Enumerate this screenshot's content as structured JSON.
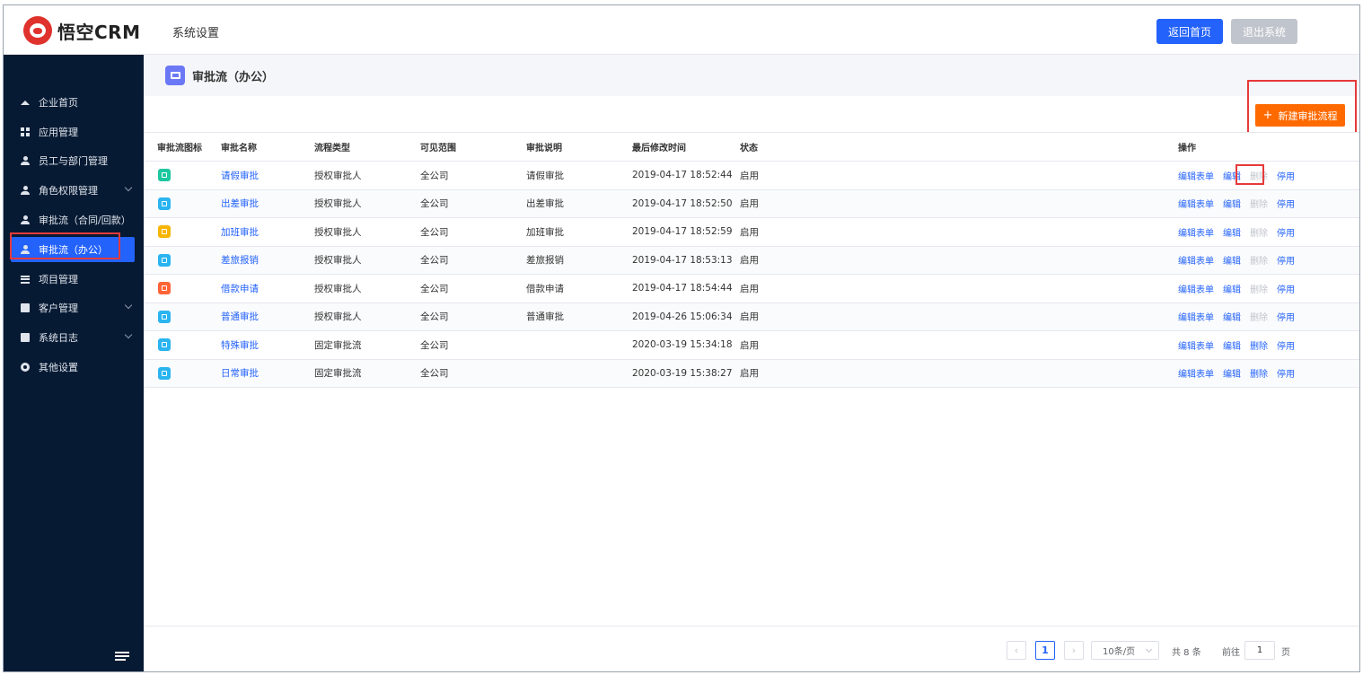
{
  "header": {
    "logo_text": "悟空CRM",
    "page_title": "系统设置",
    "home_button": "返回首页",
    "exit_button": "退出系统"
  },
  "sidebar": {
    "items": [
      {
        "label": "企业首页",
        "icon": "home-icon",
        "expandable": false,
        "active": false
      },
      {
        "label": "应用管理",
        "icon": "apps-grid-icon",
        "expandable": false,
        "active": false
      },
      {
        "label": "员工与部门管理",
        "icon": "users-icon",
        "expandable": false,
        "active": false
      },
      {
        "label": "角色权限管理",
        "icon": "user-role-icon",
        "expandable": true,
        "active": false
      },
      {
        "label": "审批流（合同/回款）",
        "icon": "user-flow-icon",
        "expandable": false,
        "active": false
      },
      {
        "label": "审批流（办公）",
        "icon": "user-flow-icon",
        "expandable": false,
        "active": true
      },
      {
        "label": "项目管理",
        "icon": "list-icon",
        "expandable": false,
        "active": false
      },
      {
        "label": "客户管理",
        "icon": "building-icon",
        "expandable": true,
        "active": false
      },
      {
        "label": "系统日志",
        "icon": "log-icon",
        "expandable": true,
        "active": false
      },
      {
        "label": "其他设置",
        "icon": "gear-icon",
        "expandable": false,
        "active": false
      }
    ]
  },
  "main": {
    "breadcrumb_title": "审批流（办公）",
    "new_button": "新建审批流程",
    "columns": [
      "审批流图标",
      "审批名称",
      "流程类型",
      "可见范围",
      "审批说明",
      "最后修改时间",
      "状态",
      "操作"
    ],
    "rows": [
      {
        "icon_color": "#1dc7a0",
        "name": "请假审批",
        "type": "授权审批人",
        "scope": "全公司",
        "desc": "请假审批",
        "modified": "2019-04-17 18:52:44",
        "status": "启用",
        "delete_disabled": true
      },
      {
        "icon_color": "#2ab4f0",
        "name": "出差审批",
        "type": "授权审批人",
        "scope": "全公司",
        "desc": "出差审批",
        "modified": "2019-04-17 18:52:50",
        "status": "启用",
        "delete_disabled": true
      },
      {
        "icon_color": "#f7b500",
        "name": "加班审批",
        "type": "授权审批人",
        "scope": "全公司",
        "desc": "加班审批",
        "modified": "2019-04-17 18:52:59",
        "status": "启用",
        "delete_disabled": true
      },
      {
        "icon_color": "#2ab4f0",
        "name": "差旅报销",
        "type": "授权审批人",
        "scope": "全公司",
        "desc": "差旅报销",
        "modified": "2019-04-17 18:53:13",
        "status": "启用",
        "delete_disabled": true
      },
      {
        "icon_color": "#ff6437",
        "name": "借款申请",
        "type": "授权审批人",
        "scope": "全公司",
        "desc": "借款申请",
        "modified": "2019-04-17 18:54:44",
        "status": "启用",
        "delete_disabled": true
      },
      {
        "icon_color": "#2ab4f0",
        "name": "普通审批",
        "type": "授权审批人",
        "scope": "全公司",
        "desc": "普通审批",
        "modified": "2019-04-26 15:06:34",
        "status": "启用",
        "delete_disabled": true
      },
      {
        "icon_color": "#2ab4f0",
        "name": "特殊审批",
        "type": "固定审批流",
        "scope": "全公司",
        "desc": "",
        "modified": "2020-03-19 15:34:18",
        "status": "启用",
        "delete_disabled": false
      },
      {
        "icon_color": "#2ab4f0",
        "name": "日常审批",
        "type": "固定审批流",
        "scope": "全公司",
        "desc": "",
        "modified": "2020-03-19 15:38:27",
        "status": "启用",
        "delete_disabled": false
      }
    ],
    "ops": {
      "edit_form": "编辑表单",
      "edit": "编辑",
      "delete": "删除",
      "disable": "停用"
    }
  },
  "pagination": {
    "current_page": "1",
    "page_size": "10条/页",
    "total": "共 8 条",
    "goto_label": "前往",
    "goto_value": "1",
    "goto_unit": "页"
  },
  "colors": {
    "sidebar_bg": "#071a33",
    "primary": "#2362fb",
    "accent_orange": "#ff6a00",
    "highlight_red": "#e63a3a"
  }
}
